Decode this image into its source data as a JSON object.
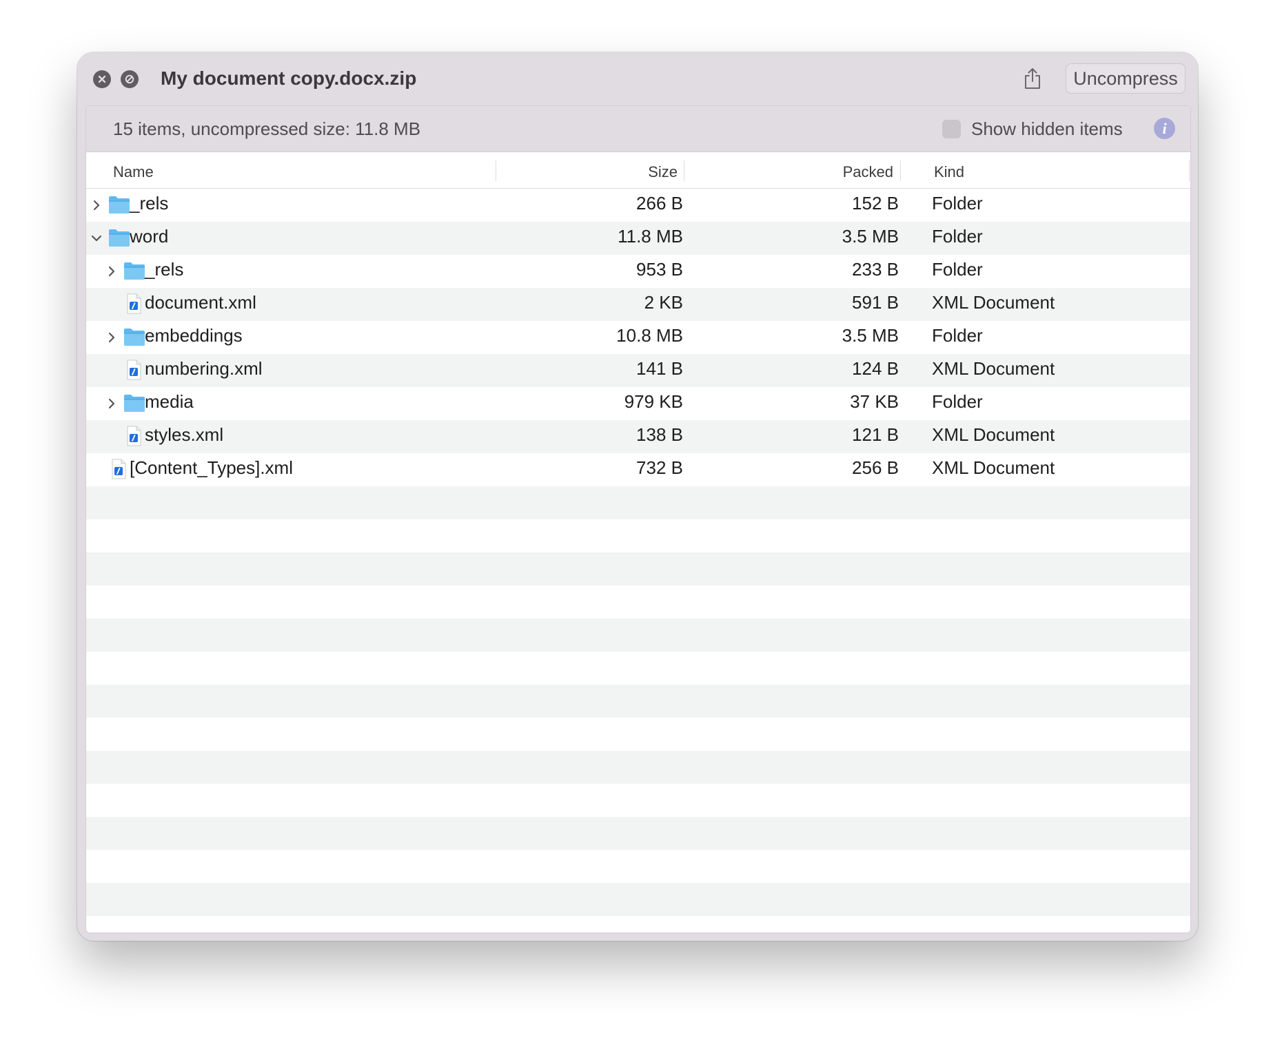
{
  "window": {
    "title": "My document copy.docx.zip",
    "uncompress_label": "Uncompress"
  },
  "infobar": {
    "summary": "15 items, uncompressed size: 11.8 MB",
    "show_hidden_label": "Show hidden items",
    "show_hidden_checked": false,
    "info_glyph": "i"
  },
  "columns": {
    "name": "Name",
    "size": "Size",
    "packed": "Packed",
    "kind": "Kind"
  },
  "rows": [
    {
      "name": "_rels",
      "size": "266 B",
      "packed": "152 B",
      "kind": "Folder",
      "type": "folder",
      "depth": 0,
      "expander": "collapsed"
    },
    {
      "name": "word",
      "size": "11.8 MB",
      "packed": "3.5 MB",
      "kind": "Folder",
      "type": "folder",
      "depth": 0,
      "expander": "expanded"
    },
    {
      "name": "_rels",
      "size": "953 B",
      "packed": "233 B",
      "kind": "Folder",
      "type": "folder",
      "depth": 1,
      "expander": "collapsed"
    },
    {
      "name": "document.xml",
      "size": "2 KB",
      "packed": "591 B",
      "kind": "XML Document",
      "type": "xml",
      "depth": 1,
      "expander": "none"
    },
    {
      "name": "embeddings",
      "size": "10.8 MB",
      "packed": "3.5 MB",
      "kind": "Folder",
      "type": "folder",
      "depth": 1,
      "expander": "collapsed"
    },
    {
      "name": "numbering.xml",
      "size": "141 B",
      "packed": "124 B",
      "kind": "XML Document",
      "type": "xml",
      "depth": 1,
      "expander": "none"
    },
    {
      "name": "media",
      "size": "979 KB",
      "packed": "37 KB",
      "kind": "Folder",
      "type": "folder",
      "depth": 1,
      "expander": "collapsed"
    },
    {
      "name": "styles.xml",
      "size": "138 B",
      "packed": "121 B",
      "kind": "XML Document",
      "type": "xml",
      "depth": 1,
      "expander": "none"
    },
    {
      "name": "[Content_Types].xml",
      "size": "732 B",
      "packed": "256 B",
      "kind": "XML Document",
      "type": "xml",
      "depth": 0,
      "expander": "none"
    }
  ],
  "colors": {
    "window_bg": "#e0dce2",
    "folder_blue": "#5fb9ee",
    "xml_badge_blue": "#1f6fe0",
    "row_alt": "#f2f3f3",
    "info_button": "#a8a9d9"
  },
  "icons": {
    "close": "close-icon",
    "stop": "stop-icon",
    "share": "share-icon",
    "folder": "folder-icon",
    "xml": "xml-document-icon",
    "chevron_right": "chevron-right-icon",
    "chevron_down": "chevron-down-icon",
    "info": "info-icon"
  }
}
